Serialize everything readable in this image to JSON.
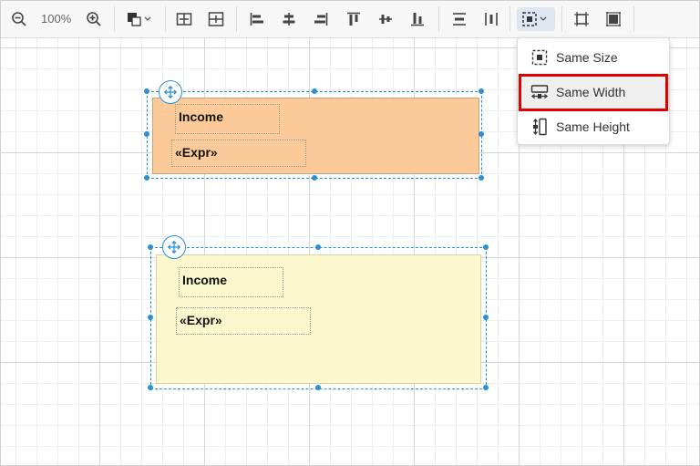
{
  "toolbar": {
    "zoom_level": "100%",
    "icons": [
      "zoom-out-icon",
      "zoom-in-icon",
      "fill-color-icon",
      "align-left-icon",
      "align-center-icon",
      "align-right-icon",
      "align-top-icon",
      "align-middle-icon",
      "align-bottom-icon",
      "distribute-horizontal-icon",
      "distribute-vertical-icon",
      "same-size-icon",
      "fit-to-grid-icon",
      "size-to-grid-icon"
    ]
  },
  "bands": [
    {
      "background": "#fcca98",
      "fields": [
        {
          "text": "Income"
        },
        {
          "text": "«Expr»"
        }
      ]
    },
    {
      "background": "#faf7cc",
      "fields": [
        {
          "text": "Income"
        },
        {
          "text": "«Expr»"
        }
      ]
    }
  ],
  "dropdown": {
    "items": [
      {
        "label": "Same Size",
        "icon": "same-size-icon"
      },
      {
        "label": "Same Width",
        "icon": "same-width-icon"
      },
      {
        "label": "Same Height",
        "icon": "same-height-icon"
      }
    ]
  },
  "colors": {
    "accent": "#2a8fd6",
    "highlight": "#e00000"
  }
}
